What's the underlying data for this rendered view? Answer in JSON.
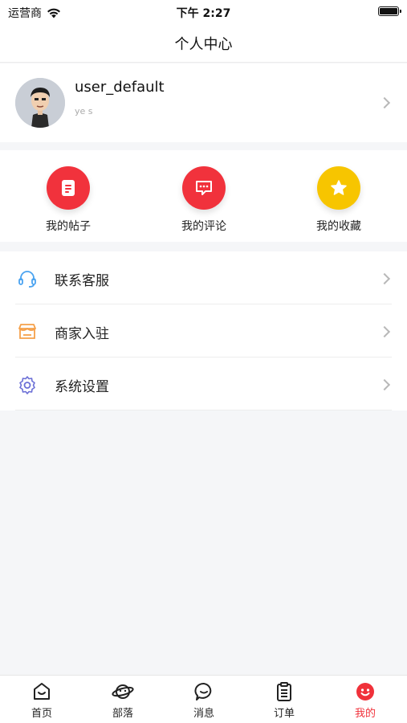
{
  "status_bar": {
    "carrier": "运营商",
    "time": "下午 2:27"
  },
  "header": {
    "title": "个人中心"
  },
  "profile": {
    "username": "user_default",
    "subtitle": "ye s"
  },
  "quick_actions": [
    {
      "label": "我的帖子",
      "icon": "document-icon",
      "color": "#f1323c"
    },
    {
      "label": "我的评论",
      "icon": "comment-icon",
      "color": "#f1323c"
    },
    {
      "label": "我的收藏",
      "icon": "star-icon",
      "color": "#f7c500"
    }
  ],
  "menu": [
    {
      "label": "联系客服",
      "icon": "headset-icon",
      "color": "#4aa3f0"
    },
    {
      "label": "商家入驻",
      "icon": "store-icon",
      "color": "#f5a04a"
    },
    {
      "label": "系统设置",
      "icon": "gear-icon",
      "color": "#6b6fd6"
    }
  ],
  "tab_bar": {
    "items": [
      {
        "label": "首页",
        "icon": "home-icon"
      },
      {
        "label": "部落",
        "icon": "planet-icon"
      },
      {
        "label": "消息",
        "icon": "message-icon"
      },
      {
        "label": "订单",
        "icon": "order-icon"
      },
      {
        "label": "我的",
        "icon": "profile-icon",
        "active": true
      }
    ],
    "active_color": "#f0313a"
  }
}
